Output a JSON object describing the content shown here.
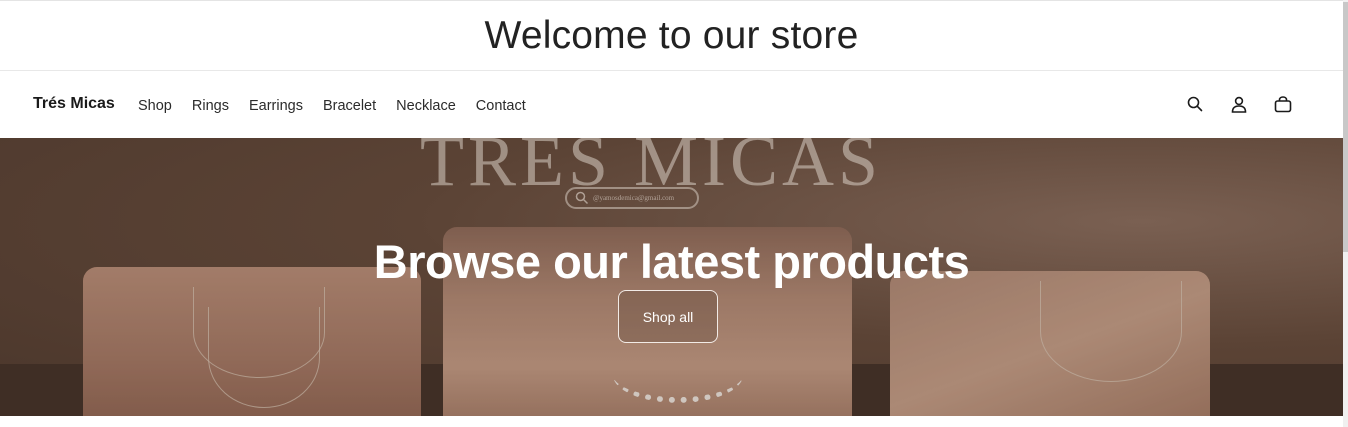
{
  "announcement": {
    "text": "Welcome to our store"
  },
  "header": {
    "brand": "Trés Micas",
    "nav": [
      "Shop",
      "Rings",
      "Earrings",
      "Bracelet",
      "Necklace",
      "Contact"
    ],
    "icons": [
      "search-icon",
      "account-icon",
      "cart-icon"
    ]
  },
  "hero": {
    "title": "Browse our latest products",
    "button_label": "Shop all",
    "background_logo": "TRÉS MICAS",
    "background_search_text": "@yamosdemica@gmail.com"
  },
  "colors": {
    "hero_overlay": "#5a4236",
    "text_dark": "#121212",
    "button_border": "#f2ebe6"
  }
}
